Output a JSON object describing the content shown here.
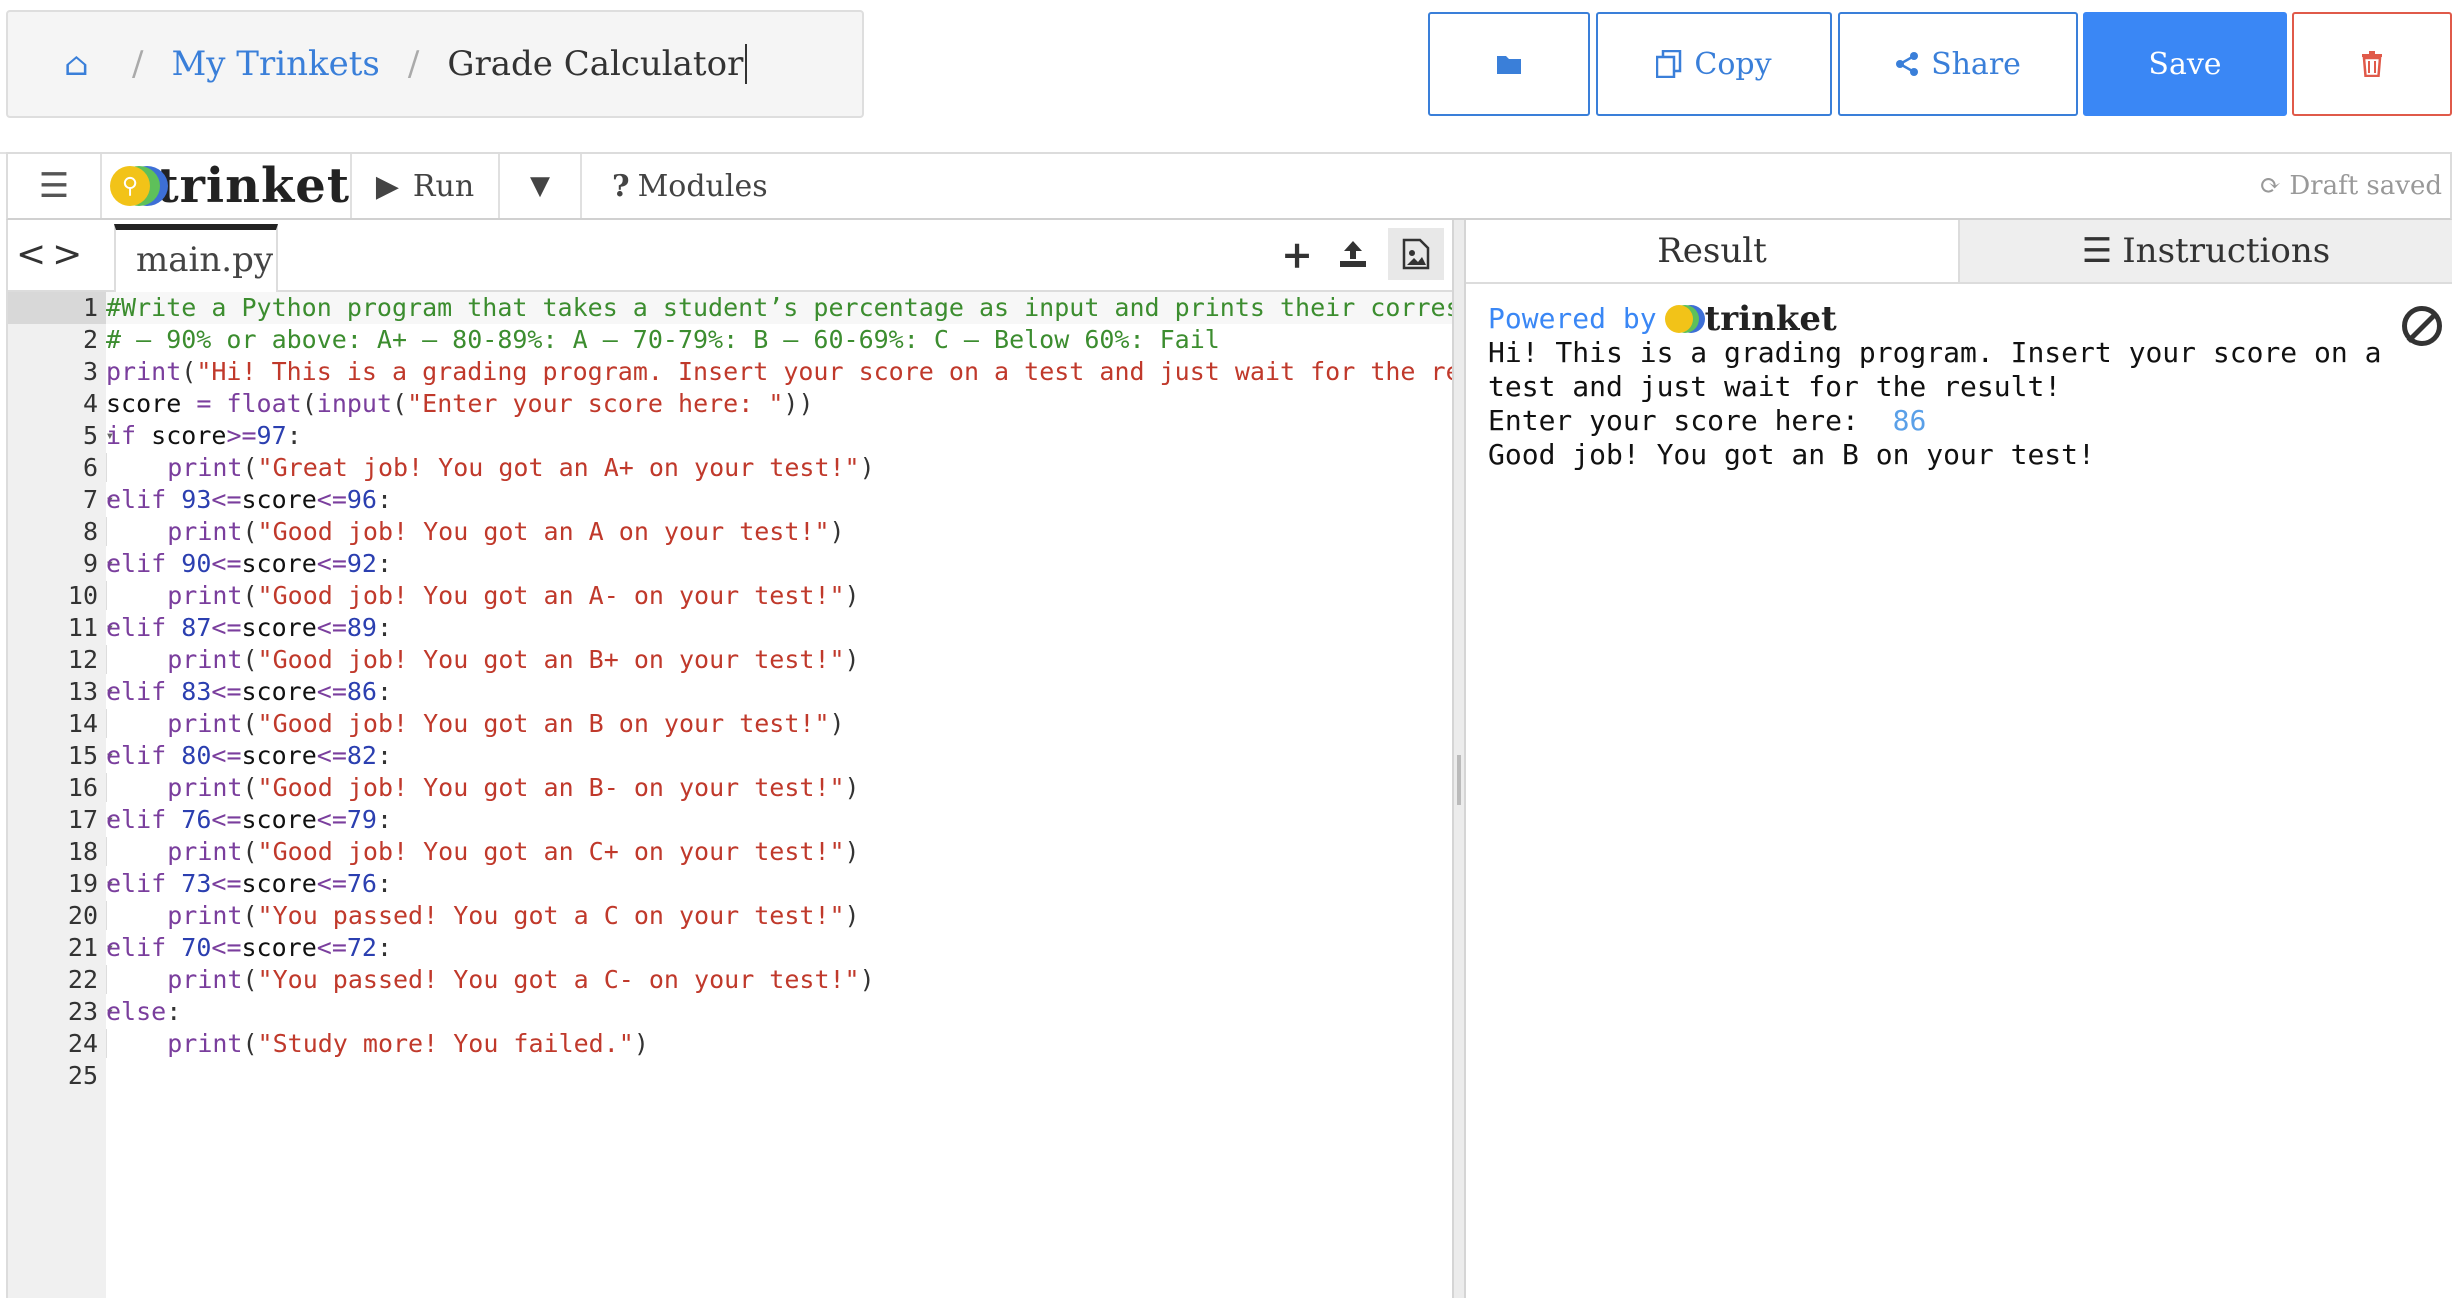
{
  "breadcrumb": {
    "home_icon": "home-icon",
    "link": "My Trinkets",
    "separator": "/",
    "current": "Grade Calculator"
  },
  "top_buttons": {
    "folder_icon": "folder-icon",
    "copy": "Copy",
    "share": "Share",
    "save": "Save",
    "delete_icon": "trash-icon"
  },
  "toolbar": {
    "menu_icon": "hamburger-icon",
    "logo_text": "trinket",
    "run": "Run",
    "modules": "Modules",
    "draft": "Draft saved"
  },
  "editor": {
    "file_tab": "main.py",
    "lines": [
      "#Write a Python program that takes a student’s percentage as input and prints their correspon",
      "# – 90% or above: A+ – 80-89%: A – 70-79%: B – 60-69%: C – Below 60%: Fail",
      "print(\"Hi! This is a grading program. Insert your score on a test and just wait for the resul",
      "score = float(input(\"Enter your score here: \"))",
      "if score>=97:",
      "    print(\"Great job! You got an A+ on your test!\")",
      "elif 93<=score<=96:",
      "    print(\"Good job! You got an A on your test!\")",
      "elif 90<=score<=92:",
      "    print(\"Good job! You got an A- on your test!\")",
      "elif 87<=score<=89:",
      "    print(\"Good job! You got an B+ on your test!\")",
      "elif 83<=score<=86:",
      "    print(\"Good job! You got an B on your test!\")",
      "elif 80<=score<=82:",
      "    print(\"Good job! You got an B- on your test!\")",
      "elif 76<=score<=79:",
      "    print(\"Good job! You got an C+ on your test!\")",
      "elif 73<=score<=76:",
      "    print(\"You passed! You got a C on your test!\")",
      "elif 70<=score<=72:",
      "    print(\"You passed! You got a C- on your test!\")",
      "else:",
      "    print(\"Study more! You failed.\")",
      ""
    ]
  },
  "output": {
    "tab_result": "Result",
    "tab_instructions": "Instructions",
    "powered_by": "Powered by",
    "brand": "trinket",
    "console_lines": [
      "Hi! This is a grading program. Insert your score on a",
      "test and just wait for the result!"
    ],
    "prompt": "Enter your score here: ",
    "input_value": "86",
    "result_line": "Good job! You got an B on your test!"
  }
}
